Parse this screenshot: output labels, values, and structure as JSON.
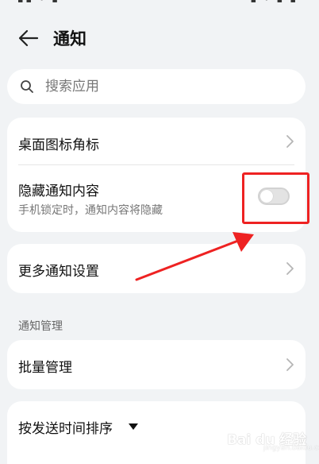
{
  "header": {
    "title": "通知"
  },
  "search": {
    "placeholder": "搜索应用",
    "icon": "search-icon"
  },
  "settings_card": {
    "desktop_badge_label": "桌面图标角标",
    "hide_content_label": "隐藏通知内容",
    "hide_content_description": "手机锁定时，通知内容将隐藏",
    "hide_content_enabled": false
  },
  "more_settings": {
    "label": "更多通知设置"
  },
  "notification_management": {
    "section_title": "通知管理",
    "batch_label": "批量管理",
    "sort_label": "按发送时间排序"
  },
  "watermark": {
    "text": "Bai du 经验",
    "sub": "jingyan.baidu.com"
  },
  "colors": {
    "background": "#f1f3f5",
    "card": "#ffffff",
    "annotation": "#ee2222",
    "toggle_off": "#e3e3e3"
  }
}
